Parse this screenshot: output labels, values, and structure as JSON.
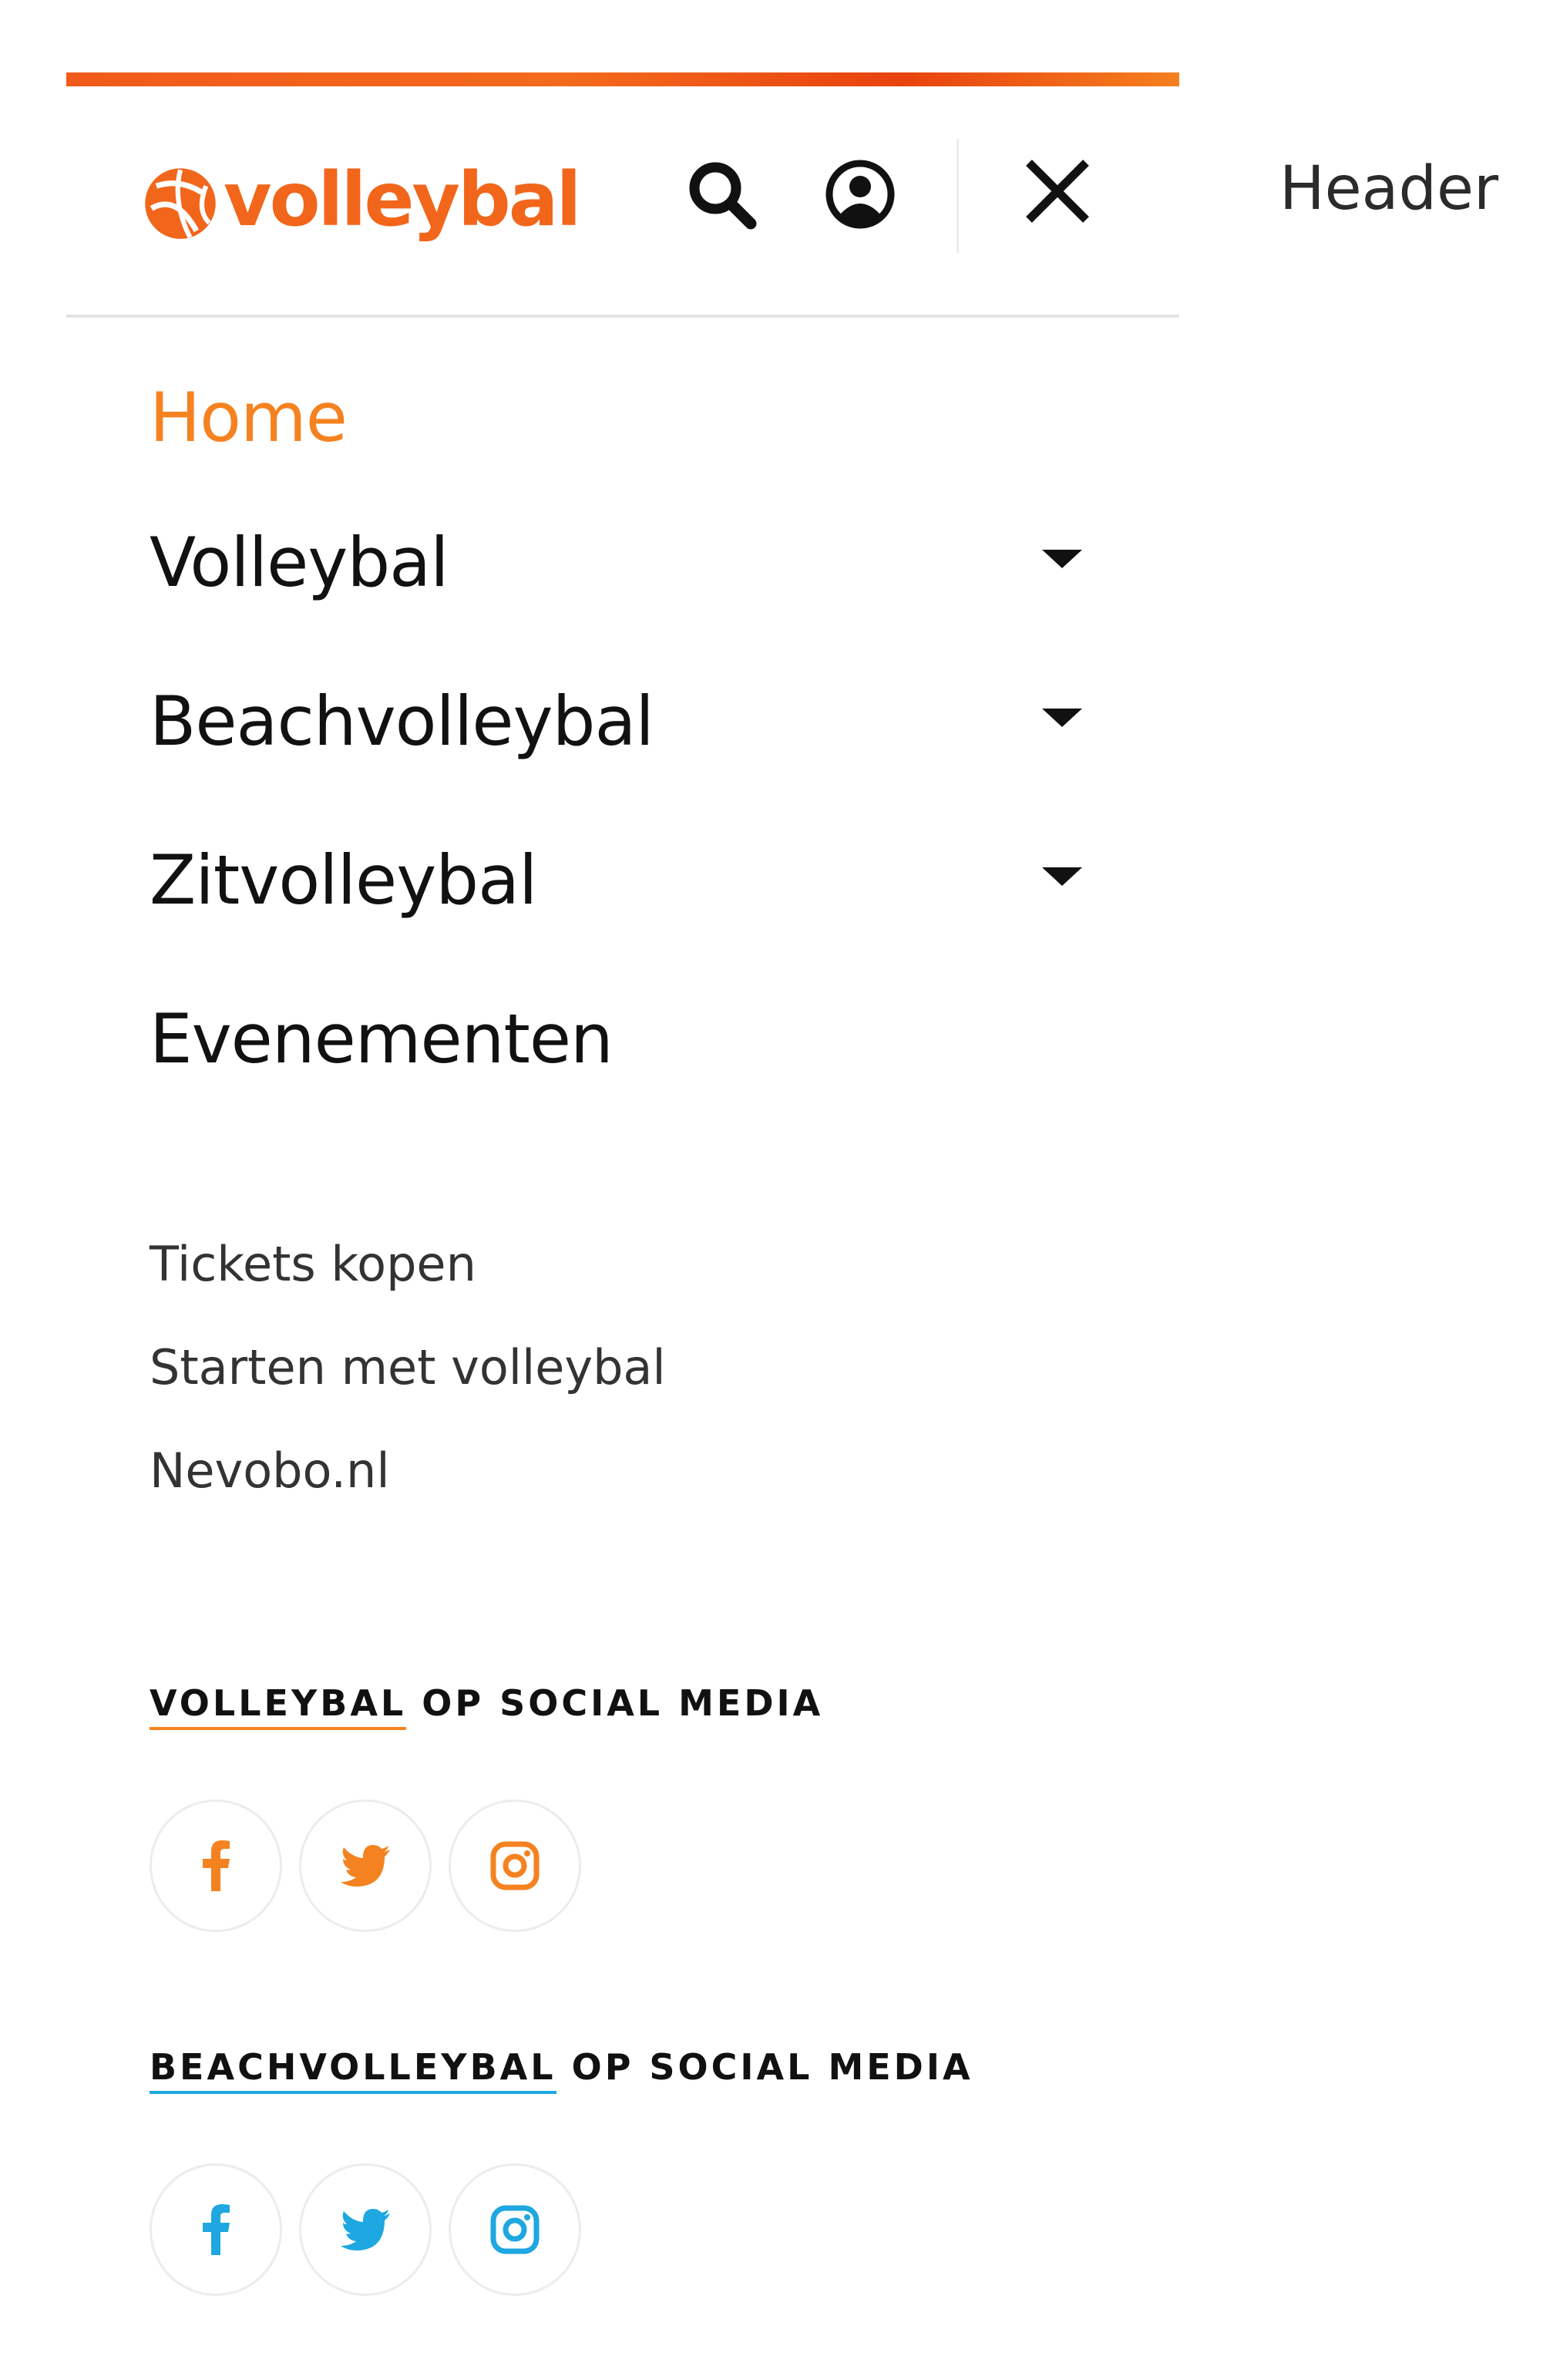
{
  "header": {
    "logo_text": "volleybal",
    "side_label": "Header"
  },
  "nav": {
    "items": [
      {
        "label": "Home",
        "active": true,
        "has_dropdown": false
      },
      {
        "label": "Volleybal",
        "active": false,
        "has_dropdown": true
      },
      {
        "label": "Beachvolleybal",
        "active": false,
        "has_dropdown": true
      },
      {
        "label": "Zitvolleybal",
        "active": false,
        "has_dropdown": true
      },
      {
        "label": "Evenementen",
        "active": false,
        "has_dropdown": false
      }
    ]
  },
  "secondary_links": [
    {
      "label": "Tickets kopen"
    },
    {
      "label": "Starten met volleybal"
    },
    {
      "label": "Nevobo.nl"
    }
  ],
  "social_sections": [
    {
      "brand": "VOLLEYBAL",
      "rest": " OP SOCIAL MEDIA",
      "accent_color": "#f58220",
      "icons": [
        "facebook-icon",
        "twitter-icon",
        "instagram-icon"
      ]
    },
    {
      "brand": "BEACHVOLLEYBAL",
      "rest": " OP SOCIAL MEDIA",
      "accent_color": "#1ea7e0",
      "icons": [
        "facebook-icon",
        "twitter-icon",
        "instagram-icon"
      ]
    }
  ],
  "colors": {
    "brand_orange": "#f58220",
    "beach_blue": "#1ea7e0",
    "text_dark": "#111111"
  }
}
